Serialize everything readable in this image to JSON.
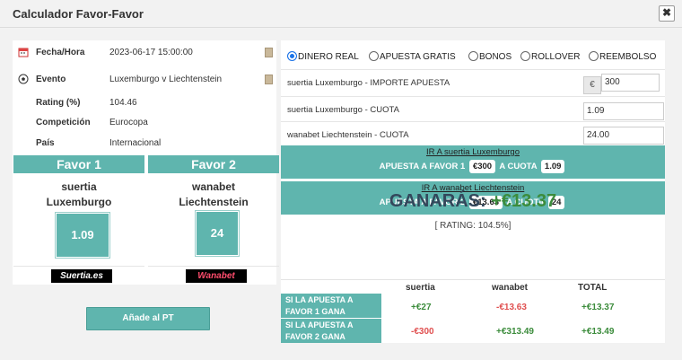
{
  "window": {
    "title": "Calculador Favor-Favor",
    "close_label": "✖"
  },
  "event_info": [
    {
      "icon": "calendar-icon",
      "label": "Fecha/Hora",
      "value": "2023-06-17 15:00:00"
    },
    {
      "icon": "soccer-ball-icon",
      "label": "Evento",
      "value": "Luxemburgo v Liechtenstein"
    },
    {
      "icon": "",
      "label": "Rating (%)",
      "value": "104.46"
    },
    {
      "icon": "",
      "label": "Competición",
      "value": "Eurocopa"
    },
    {
      "icon": "",
      "label": "País",
      "value": "Internacional"
    }
  ],
  "favor": [
    {
      "header": "Favor 1",
      "bookmaker_line1": "suertia",
      "bookmaker_line2": "Luxemburgo",
      "odds": "1.09",
      "logo_text": "Suertia.es"
    },
    {
      "header": "Favor 2",
      "bookmaker_line1": "wanabet",
      "bookmaker_line2": "Liechtenstein",
      "odds": "24",
      "logo_text": "Wanabet"
    }
  ],
  "add_button": "Añade al PT",
  "radio_options": [
    {
      "label": "DINERO REAL",
      "selected": true
    },
    {
      "label": "APUESTA GRATIS",
      "selected": false
    },
    {
      "label": "BONOS",
      "selected": false
    },
    {
      "label": "ROLLOVER",
      "selected": false
    },
    {
      "label": "REEMBOLSO",
      "selected": false
    }
  ],
  "inputs": [
    {
      "label": "suertia Luxemburgo - IMPORTE APUESTA",
      "currency": "€",
      "value": "300"
    },
    {
      "label": "suertia Luxemburgo - CUOTA",
      "value": "1.09"
    },
    {
      "label": "wanabet Liechtenstein  - CUOTA",
      "value": "24.00"
    }
  ],
  "bets": [
    {
      "link": "IR A suertia Luxemburgo",
      "label": "APUESTA A FAVOR 1",
      "amount": "€300",
      "cuota_label": "A CUOTA",
      "cuota": "1.09"
    },
    {
      "link": "IR A wanabet Liechtenstein",
      "label": "APUESTA A FAVOR 2",
      "amount": "€13.63",
      "cuota_label": "A CUOTA",
      "cuota": "24"
    }
  ],
  "result": {
    "prefix": "GANARÁS:",
    "amount": "+€13.37",
    "rating": "[ RATING: 104.5%]"
  },
  "table": {
    "headers": [
      "suertia",
      "wanabet",
      "TOTAL"
    ],
    "rows": [
      {
        "label": "SI LA APUESTA A FAVOR 1 GANA",
        "values": [
          "+€27",
          "-€13.63",
          "+€13.37"
        ],
        "signs": [
          "pos",
          "neg",
          "pos"
        ]
      },
      {
        "label": "SI LA APUESTA A FAVOR 2 GANA",
        "values": [
          "-€300",
          "+€313.49",
          "+€13.49"
        ],
        "signs": [
          "neg",
          "pos",
          "pos"
        ]
      }
    ]
  },
  "colors": {
    "teal": "#5fb5ae",
    "positive": "#3c8c3c",
    "negative": "#e05050",
    "title": "#33475b"
  }
}
